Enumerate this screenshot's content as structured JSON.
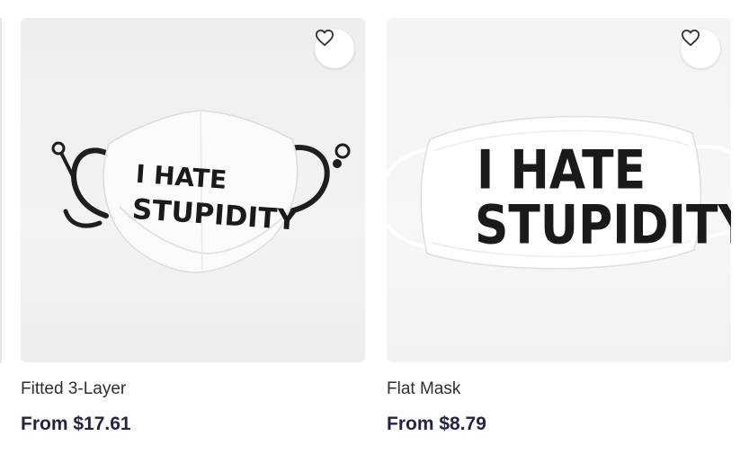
{
  "products": [
    {
      "name": "Fitted 3-Layer",
      "price": "From $17.61",
      "print_line1": "I HATE",
      "print_line2": "STUPIDITY"
    },
    {
      "name": "Flat Mask",
      "price": "From $8.79",
      "print_line1": "I HATE",
      "print_line2": "STUPIDITY"
    }
  ],
  "icons": {
    "favorite": "heart-outline-icon"
  },
  "colors": {
    "title_text": "#2d2d3c",
    "price_text": "#24244a"
  }
}
